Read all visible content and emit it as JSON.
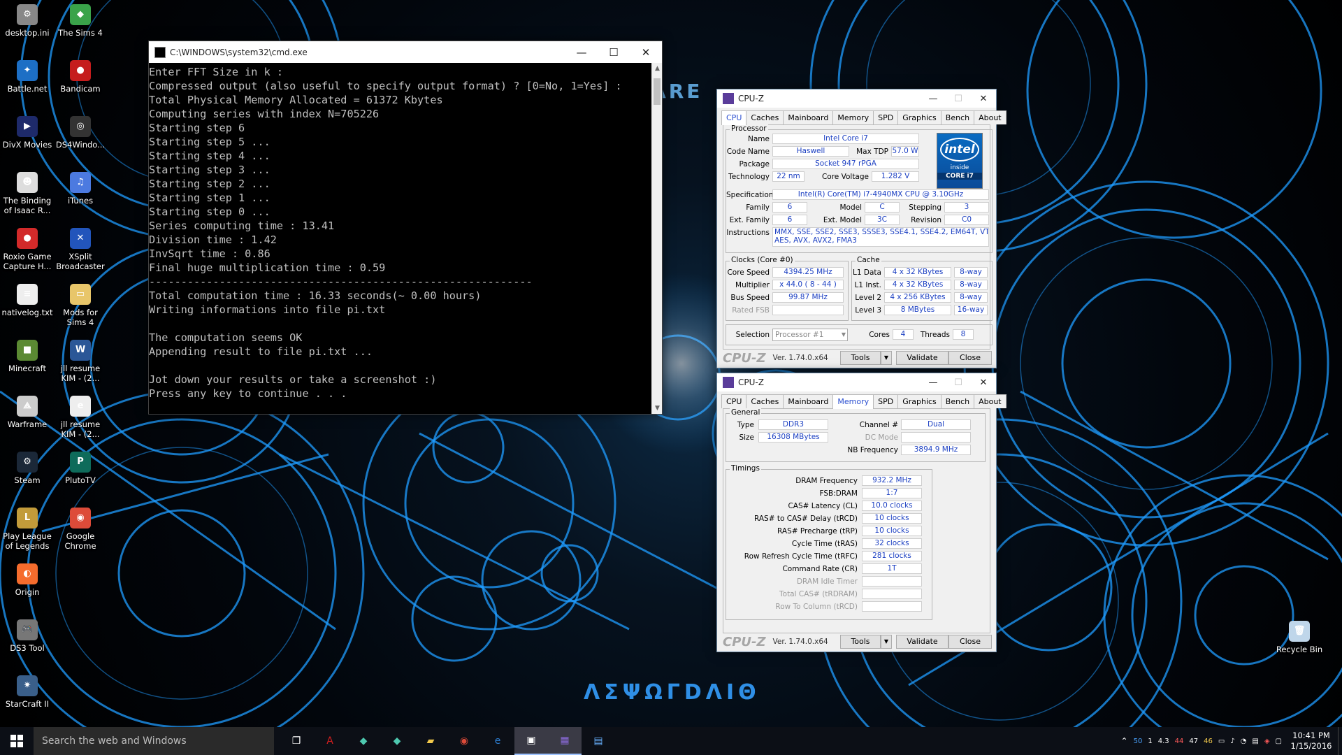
{
  "desktop_icons": [
    {
      "label": "desktop.ini",
      "color": "#888888",
      "glyph": "⚙"
    },
    {
      "label": "The Sims 4",
      "color": "#3aa34a",
      "glyph": "◆"
    },
    {
      "label": "Battle.net",
      "color": "#1d6fc5",
      "glyph": "✦"
    },
    {
      "label": "Bandicam",
      "color": "#c51d1d",
      "glyph": "●"
    },
    {
      "label": "DivX Movies",
      "color": "#1e2a6a",
      "glyph": "▶"
    },
    {
      "label": "DS4Windo...",
      "color": "#333333",
      "glyph": "◎"
    },
    {
      "label": "The Binding of Isaac R...",
      "color": "#dddddd",
      "glyph": "☻"
    },
    {
      "label": "iTunes",
      "color": "#4c7ae0",
      "glyph": "♫"
    },
    {
      "label": "Roxio Game Capture H...",
      "color": "#d22a2a",
      "glyph": "●"
    },
    {
      "label": "XSplit Broadcaster",
      "color": "#2255bb",
      "glyph": "✕"
    },
    {
      "label": "nativelog.txt",
      "color": "#eeeeee",
      "glyph": "≡"
    },
    {
      "label": "Mods for Sims 4",
      "color": "#e8c66a",
      "glyph": "▭"
    },
    {
      "label": "Minecraft",
      "color": "#5b8a33",
      "glyph": "■"
    },
    {
      "label": "jll resume KIM - (2...",
      "color": "#2b5797",
      "glyph": "W"
    },
    {
      "label": "Warframe",
      "color": "#cccccc",
      "glyph": "⟁"
    },
    {
      "label": "jll resume KIM - (2...",
      "color": "#eeeeee",
      "glyph": "e"
    },
    {
      "label": "Steam",
      "color": "#1b2838",
      "glyph": "⚙"
    },
    {
      "label": "PlutoTV",
      "color": "#0e6b5a",
      "glyph": "P"
    },
    {
      "label": "Play League of Legends",
      "color": "#c29b3a",
      "glyph": "L"
    },
    {
      "label": "Google Chrome",
      "color": "#dd4b39",
      "glyph": "◉"
    },
    {
      "label": "Origin",
      "color": "#f56c2d",
      "glyph": "◐"
    },
    {
      "label": "DS3 Tool",
      "color": "#777777",
      "glyph": "🎮"
    },
    {
      "label": "StarCraft II",
      "color": "#3a5f8a",
      "glyph": "✷"
    },
    {
      "label": "Recycle Bin",
      "color": "#bfd6ea",
      "glyph": "🗑"
    }
  ],
  "cmd": {
    "title": "C:\\WINDOWS\\system32\\cmd.exe",
    "lines": [
      "Enter FFT Size in k :",
      "Compressed output (also useful to specify output format) ? [0=No, 1=Yes] :",
      "Total Physical Memory Allocated = 61372 Kbytes",
      "Computing series with index N=705226",
      "Starting step 6",
      "Starting step 5 ...",
      "Starting step 4 ...",
      "Starting step 3 ...",
      "Starting step 2 ...",
      "Starting step 1 ...",
      "Starting step 0 ...",
      "Series computing time : 13.41",
      "Division time : 1.42",
      "InvSqrt time : 0.86",
      "Final huge multiplication time : 0.59",
      "------------------------------------------------------------",
      "Total computation time : 16.33 seconds(~ 0.00 hours)",
      "Writing informations into file pi.txt",
      "",
      "The computation seems OK",
      "Appending result to file pi.txt ...",
      "",
      "Jot down your results or take a screenshot :)",
      "Press any key to continue . . ."
    ]
  },
  "cpuz_tabs": [
    "CPU",
    "Caches",
    "Mainboard",
    "Memory",
    "SPD",
    "Graphics",
    "Bench",
    "About"
  ],
  "cpuz_common": {
    "title": "CPU-Z",
    "logo": "CPU-Z",
    "version": "Ver. 1.74.0.x64",
    "tools": "Tools",
    "validate": "Validate",
    "close": "Close"
  },
  "cpu": {
    "group_processor": "Processor",
    "name_label": "Name",
    "name": "Intel Core i7",
    "codename_label": "Code Name",
    "codename": "Haswell",
    "maxtdp_label": "Max TDP",
    "maxtdp": "57.0 W",
    "package_label": "Package",
    "package": "Socket 947 rPGA",
    "technology_label": "Technology",
    "technology": "22 nm",
    "corevoltage_label": "Core Voltage",
    "corevoltage": "1.282 V",
    "spec_label": "Specification",
    "spec": "Intel(R) Core(TM) i7-4940MX CPU @ 3.10GHz",
    "family_label": "Family",
    "family": "6",
    "model_label": "Model",
    "model": "C",
    "stepping_label": "Stepping",
    "stepping": "3",
    "extfamily_label": "Ext. Family",
    "extfamily": "6",
    "extmodel_label": "Ext. Model",
    "extmodel": "3C",
    "revision_label": "Revision",
    "revision": "C0",
    "instructions_label": "Instructions",
    "instructions_1": "MMX, SSE, SSE2, SSE3, SSSE3, SSE4.1, SSE4.2, EM64T, VT-x,",
    "instructions_2": "AES, AVX, AVX2, FMA3",
    "intel_logo_1": "intel",
    "intel_logo_2": "inside",
    "intel_logo_3": "CORE i7",
    "group_clocks": "Clocks (Core #0)",
    "corespeed_label": "Core Speed",
    "corespeed": "4394.25 MHz",
    "multiplier_label": "Multiplier",
    "multiplier": "x 44.0 ( 8 - 44 )",
    "busspeed_label": "Bus Speed",
    "busspeed": "99.87 MHz",
    "ratedfsb_label": "Rated FSB",
    "ratedfsb": "",
    "group_cache": "Cache",
    "l1data_label": "L1 Data",
    "l1data": "4 x 32 KBytes",
    "l1data_way": "8-way",
    "l1inst_label": "L1 Inst.",
    "l1inst": "4 x 32 KBytes",
    "l1inst_way": "8-way",
    "level2_label": "Level 2",
    "level2": "4 x 256 KBytes",
    "level2_way": "8-way",
    "level3_label": "Level 3",
    "level3": "8 MBytes",
    "level3_way": "16-way",
    "selection_label": "Selection",
    "selection": "Processor #1",
    "cores_label": "Cores",
    "cores": "4",
    "threads_label": "Threads",
    "threads": "8"
  },
  "memory": {
    "group_general": "General",
    "type_label": "Type",
    "type": "DDR3",
    "size_label": "Size",
    "size": "16308 MBytes",
    "channel_label": "Channel #",
    "channel": "Dual",
    "dcmode_label": "DC Mode",
    "dcmode": "",
    "nbfreq_label": "NB Frequency",
    "nbfreq": "3894.9 MHz",
    "group_timings": "Timings",
    "timings": [
      {
        "label": "DRAM Frequency",
        "value": "932.2 MHz",
        "disabled": false
      },
      {
        "label": "FSB:DRAM",
        "value": "1:7",
        "disabled": false
      },
      {
        "label": "CAS# Latency (CL)",
        "value": "10.0 clocks",
        "disabled": false
      },
      {
        "label": "RAS# to CAS# Delay (tRCD)",
        "value": "10 clocks",
        "disabled": false
      },
      {
        "label": "RAS# Precharge (tRP)",
        "value": "10 clocks",
        "disabled": false
      },
      {
        "label": "Cycle Time (tRAS)",
        "value": "32 clocks",
        "disabled": false
      },
      {
        "label": "Row Refresh Cycle Time (tRFC)",
        "value": "281 clocks",
        "disabled": false
      },
      {
        "label": "Command Rate (CR)",
        "value": "1T",
        "disabled": false
      },
      {
        "label": "DRAM Idle Timer",
        "value": "",
        "disabled": true
      },
      {
        "label": "Total CAS# (tRDRAM)",
        "value": "",
        "disabled": true
      },
      {
        "label": "Row To Column (tRCD)",
        "value": "",
        "disabled": true
      }
    ]
  },
  "taskbar": {
    "search_placeholder": "Search the web and Windows",
    "apps": [
      "task-view",
      "acrobat",
      "app",
      "app",
      "file-explorer",
      "chrome",
      "edge",
      "cmd",
      "cpu-z",
      "notepad"
    ],
    "tray_numbers": [
      "50",
      "1",
      "4.3",
      "44",
      "47",
      "46"
    ],
    "time": "10:41 PM",
    "date": "1/15/2016"
  },
  "wallpaper": {
    "accent": "#1f9cff",
    "text_top": "NWARE",
    "text_bottom": "ΛΣΨΩΓDΛIΘ"
  }
}
